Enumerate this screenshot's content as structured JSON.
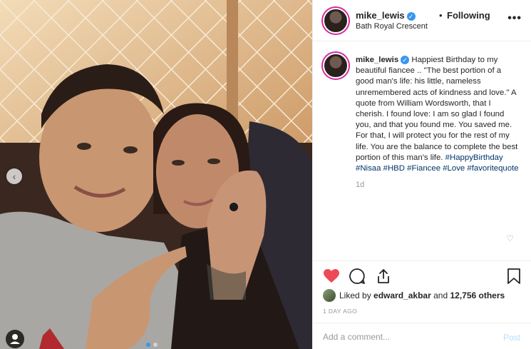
{
  "post": {
    "username": "mike_lewis",
    "follow_separator": "•",
    "follow_status": "Following",
    "location": "Bath Royal Crescent",
    "more_icon": "more-icon",
    "caption": {
      "username": "mike_lewis",
      "text": "Happiest Birthday to my beautiful fiancee .. \"The best portion of a good man's life: his little, nameless unremembered acts of kindness and love.\" A quote from William Wordsworth, that I cherish. I found love: I am so glad I found you, and that you found me. You saved me. For that, I will protect you for the rest of my life. You are the balance to complete the best portion of this man's life.",
      "hashtags": "#HappyBirthday #Nisaa #HBD #Fiancee #Love #favoritequote",
      "time": "1d"
    },
    "likes": {
      "prefix": "Liked by",
      "user": "edward_akbar",
      "and": "and",
      "count": "12,756 others"
    },
    "timestamp": "1 DAY AGO",
    "comment_placeholder": "Add a comment...",
    "post_label": "Post",
    "liked": true,
    "accent_colors": {
      "like_red": "#ed4956",
      "link_blue": "#003569",
      "verified_blue": "#3897f0",
      "post_disabled": "#b2dffc"
    }
  }
}
